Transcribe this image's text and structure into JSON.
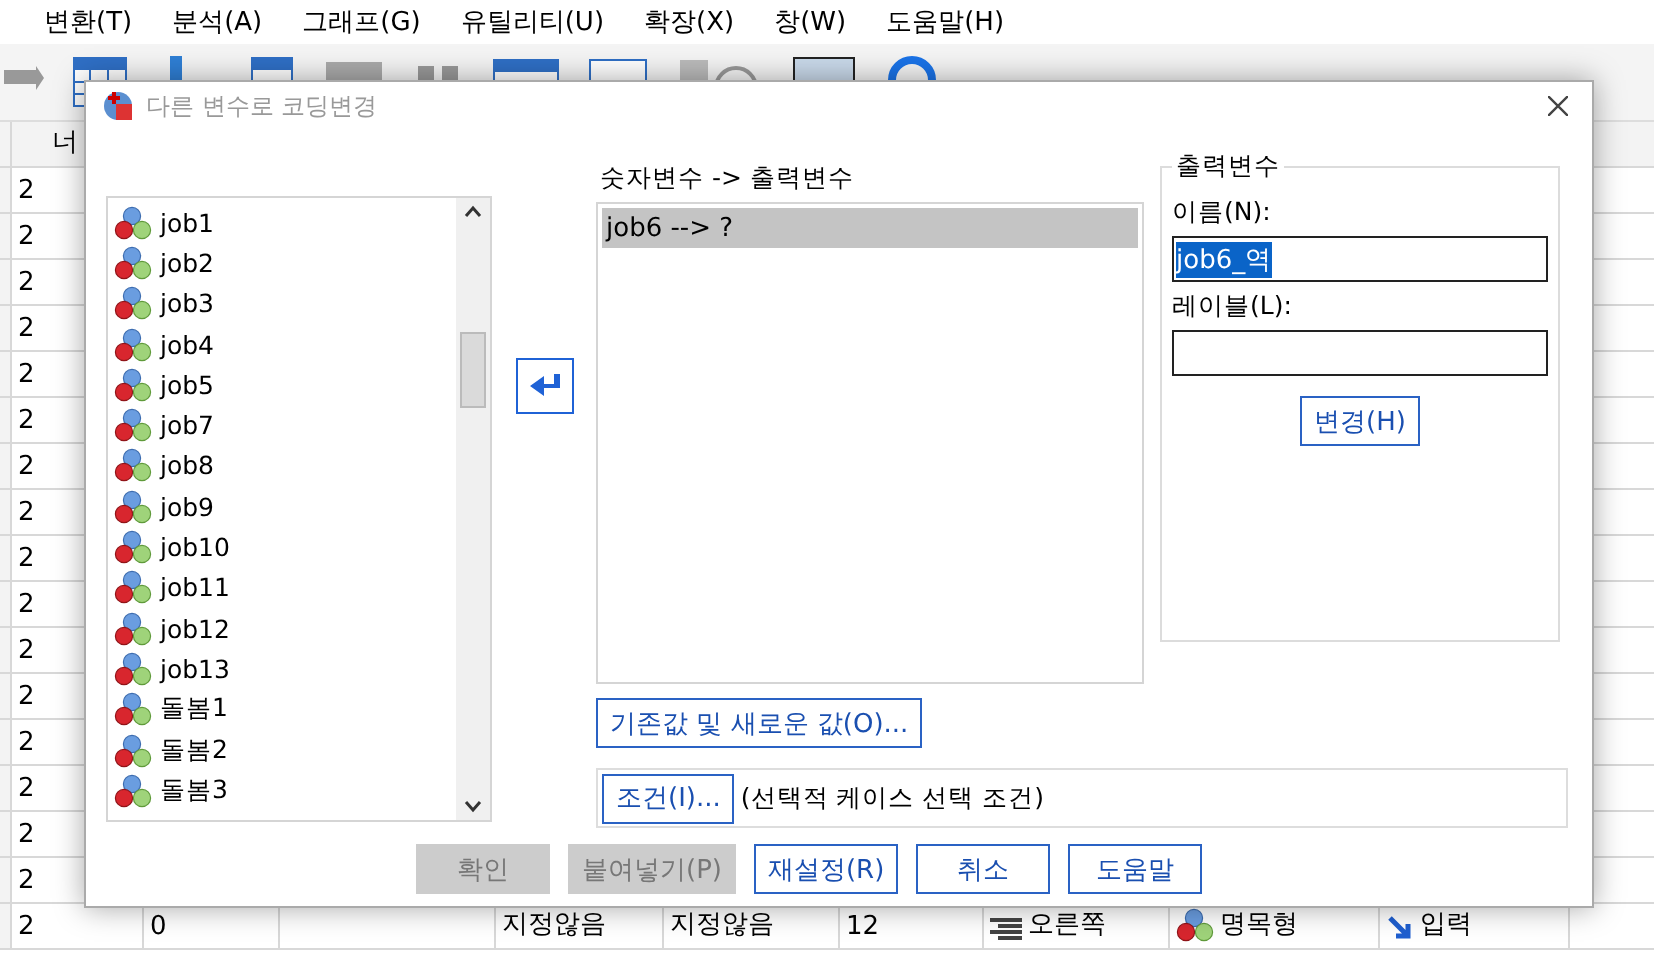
{
  "menu": [
    {
      "label": "변환(T)"
    },
    {
      "label": "분석(A)"
    },
    {
      "label": "그래프(G)"
    },
    {
      "label": "유틸리티(U)"
    },
    {
      "label": "확장(X)"
    },
    {
      "label": "창(W)"
    },
    {
      "label": "도움말(H)"
    }
  ],
  "grid": {
    "header": "너",
    "rows": [
      {
        "cells": [
          {
            "text": "2"
          }
        ]
      },
      {
        "cells": [
          {
            "text": "2"
          }
        ]
      },
      {
        "cells": [
          {
            "text": "2"
          }
        ]
      },
      {
        "cells": [
          {
            "text": "2"
          }
        ]
      },
      {
        "cells": [
          {
            "text": "2"
          }
        ]
      },
      {
        "cells": [
          {
            "text": "2"
          }
        ]
      },
      {
        "cells": [
          {
            "text": "2"
          }
        ]
      },
      {
        "cells": [
          {
            "text": "2"
          }
        ]
      },
      {
        "cells": [
          {
            "text": "2"
          }
        ]
      },
      {
        "cells": [
          {
            "text": "2"
          }
        ]
      },
      {
        "cells": [
          {
            "text": "2"
          }
        ]
      },
      {
        "cells": [
          {
            "text": "2"
          }
        ]
      },
      {
        "cells": [
          {
            "text": "2"
          }
        ]
      },
      {
        "cells": [
          {
            "text": "2"
          }
        ]
      },
      {
        "cells": [
          {
            "text": "2"
          }
        ]
      },
      {
        "cells": [
          {
            "text": "2"
          }
        ]
      },
      {
        "cells": [
          {
            "text": "2"
          },
          {
            "text": "0"
          },
          {},
          {
            "text": "지정않음"
          },
          {
            "text": "지정않음"
          },
          {
            "text": "12"
          },
          {
            "text": "오른쪽",
            "kind": "align"
          },
          {
            "text": "명목형",
            "kind": "measure"
          },
          {
            "text": "입력",
            "kind": "role"
          }
        ]
      }
    ]
  },
  "dialog": {
    "title": "다른 변수로 코딩변경",
    "active": false,
    "variables": [
      {
        "name": "job1",
        "selected": false
      },
      {
        "name": "job2",
        "selected": false
      },
      {
        "name": "job3",
        "selected": false
      },
      {
        "name": "job4",
        "selected": false
      },
      {
        "name": "job5",
        "selected": false
      },
      {
        "name": "job7",
        "selected": false
      },
      {
        "name": "job8",
        "selected": false
      },
      {
        "name": "job9",
        "selected": false
      },
      {
        "name": "job10",
        "selected": false
      },
      {
        "name": "job11",
        "selected": false
      },
      {
        "name": "job12",
        "selected": false
      },
      {
        "name": "job13",
        "selected": false
      },
      {
        "name": "돌봄1",
        "selected": false
      },
      {
        "name": "돌봄2",
        "selected": false
      },
      {
        "name": "돌봄3",
        "selected": false
      }
    ],
    "mapping": {
      "label": "숫자변수 -> 출력변수",
      "items": [
        {
          "text": "job6 --> ?",
          "selected": true
        }
      ]
    },
    "output": {
      "title": "출력변수",
      "name_label": "이름(N):",
      "name_value": "job6_역",
      "name_highlighted": true,
      "label_label": "레이블(L):",
      "change_button": "변경(H)"
    },
    "old_new_button": "기존값 및 새로운 값(O)...",
    "condition": {
      "button": "조건(I)...",
      "text": "(선택적 케이스 선택 조건)"
    },
    "buttons": [
      {
        "label": "확인",
        "disabled": true
      },
      {
        "label": "붙여넣기(P)",
        "disabled": true
      },
      {
        "label": "재설정(R)",
        "disabled": false
      },
      {
        "label": "취소",
        "disabled": false
      },
      {
        "label": "도움말",
        "disabled": false
      }
    ]
  }
}
